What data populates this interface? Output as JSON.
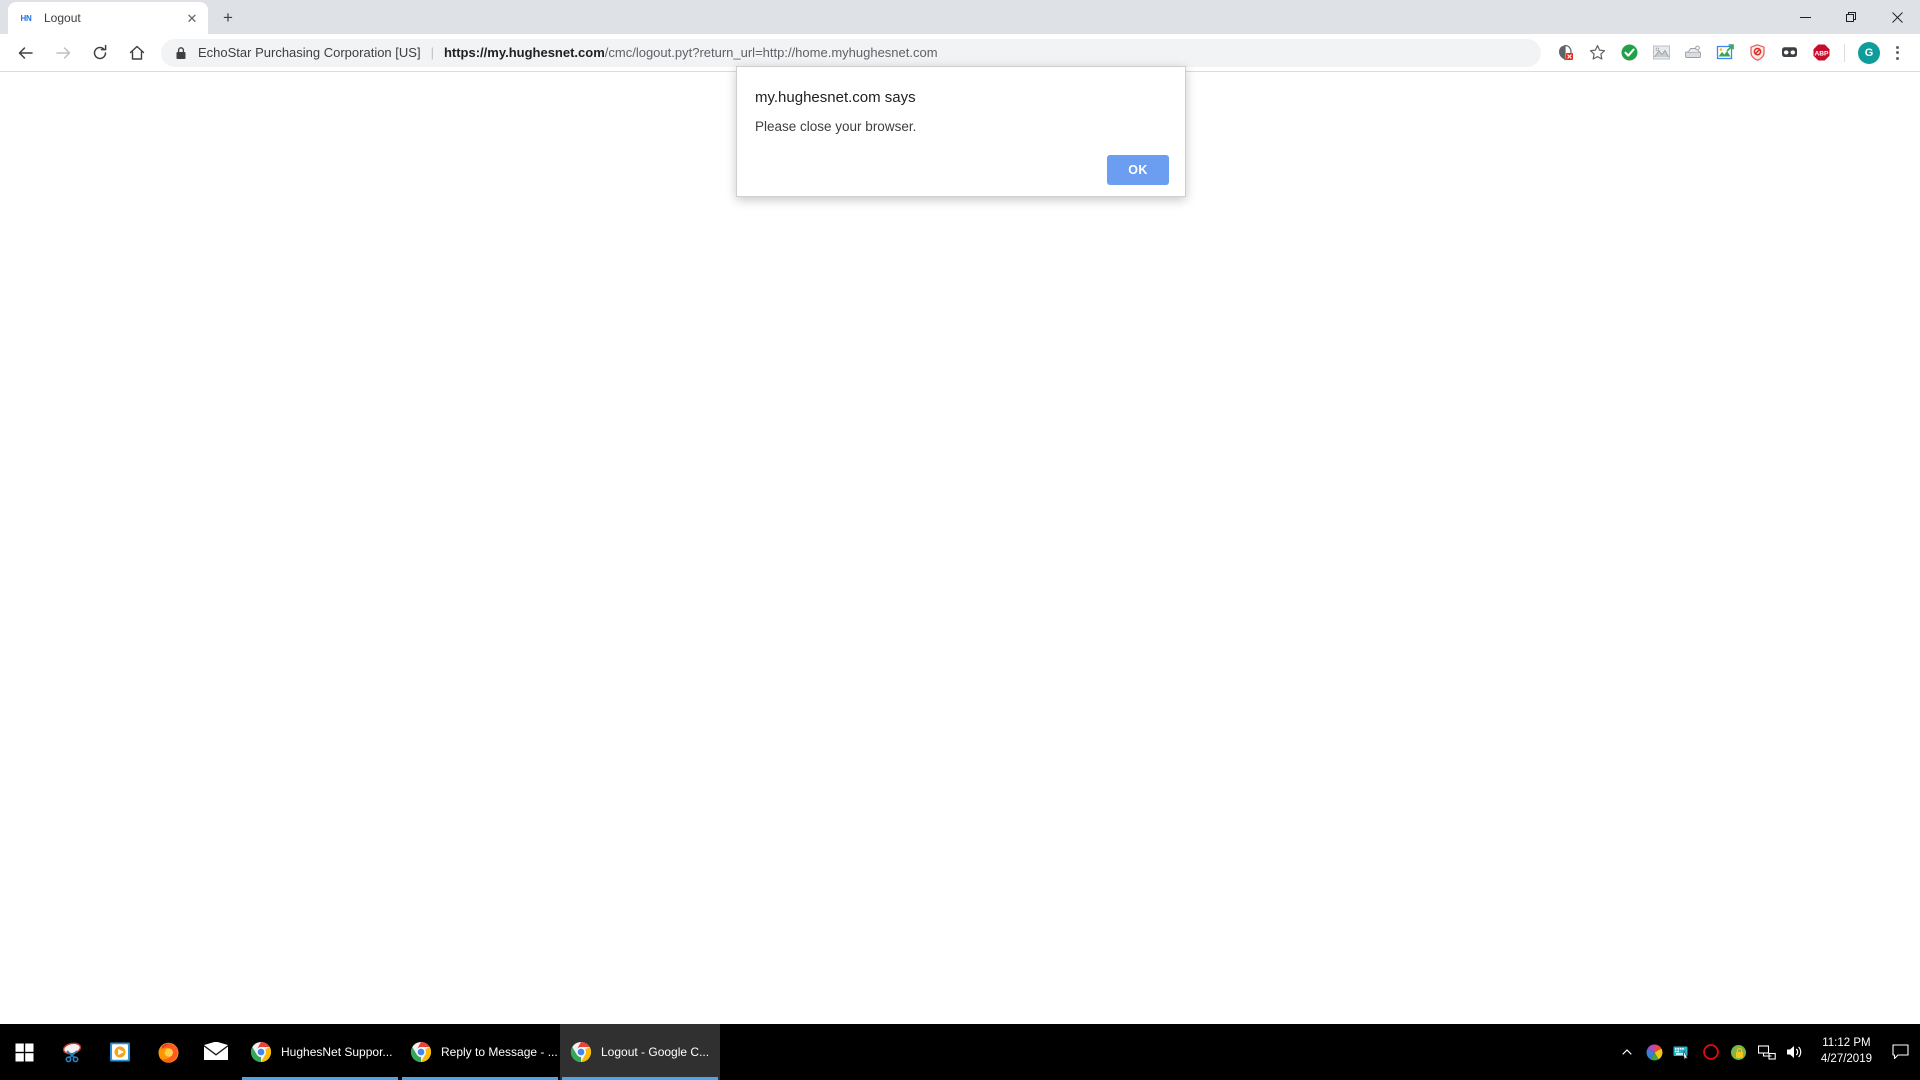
{
  "browser": {
    "tab": {
      "favicon_text": "HN",
      "favicon_name": "hughesnet-favicon",
      "title": "Logout",
      "close_label": "✕"
    },
    "new_tab_label": "+",
    "window_controls": {
      "minimize": "—",
      "restore": "❐",
      "close": "✕"
    },
    "nav": {
      "back": "back-arrow-icon",
      "forward": "forward-arrow-icon",
      "reload": "reload-icon",
      "home": "home-icon"
    },
    "omnibox": {
      "security_icon": "lock-icon",
      "site_identity": "EchoStar Purchasing Corporation [US]",
      "separator": "|",
      "url_domain": "https://my.hughesnet.com",
      "url_path": "/cmc/logout.pyt?return_url=http://home.myhughesnet.com",
      "full_url": "https://my.hughesnet.com/cmc/logout.pyt?return_url=http://home.myhughesnet.com"
    },
    "extensions": [
      {
        "name": "cookie-blocked-icon",
        "glyph": "⛉"
      },
      {
        "name": "bookmark-star-icon",
        "glyph": "☆"
      },
      {
        "name": "green-check-extension-icon",
        "glyph": "✔"
      },
      {
        "name": "image-extension-icon",
        "glyph": "⛰"
      },
      {
        "name": "grey-stamp-extension-icon",
        "glyph": "✉"
      },
      {
        "name": "screenshot-extension-icon",
        "glyph": "↗"
      },
      {
        "name": "red-shield-blocker-icon",
        "glyph": "⊘"
      },
      {
        "name": "ghostery-mask-icon",
        "glyph": "◑"
      },
      {
        "name": "adblock-plus-icon",
        "glyph": "ABP"
      }
    ],
    "profile_avatar_letter": "G",
    "menu_name": "chrome-menu-icon"
  },
  "dialog": {
    "title": "my.hughesnet.com says",
    "message": "Please close your browser.",
    "ok_label": "OK",
    "accent_color": "#6b9ef0"
  },
  "taskbar": {
    "start_name": "windows-start-button",
    "pinned": [
      {
        "name": "snipping-tool-icon"
      },
      {
        "name": "movies-and-tv-icon"
      },
      {
        "name": "firefox-icon"
      },
      {
        "name": "mail-icon"
      }
    ],
    "windows": [
      {
        "name": "taskbar-window-hughesnet-support",
        "label": "HughesNet Suppor...",
        "active": false
      },
      {
        "name": "taskbar-window-reply-to-message",
        "label": "Reply to Message - ...",
        "active": false
      },
      {
        "name": "taskbar-window-logout-chrome",
        "label": "Logout - Google C...",
        "active": true
      }
    ],
    "tray": [
      {
        "name": "show-hidden-icons-chevron",
        "glyph": "∧"
      },
      {
        "name": "color-wheel-tray-icon"
      },
      {
        "name": "keyboard-tray-icon"
      },
      {
        "name": "opera-tray-icon"
      },
      {
        "name": "security-lock-tray-icon"
      },
      {
        "name": "network-tray-icon"
      },
      {
        "name": "volume-tray-icon"
      }
    ],
    "clock_time": "11:12 PM",
    "clock_date": "4/27/2019",
    "action_center_name": "action-center-icon"
  }
}
